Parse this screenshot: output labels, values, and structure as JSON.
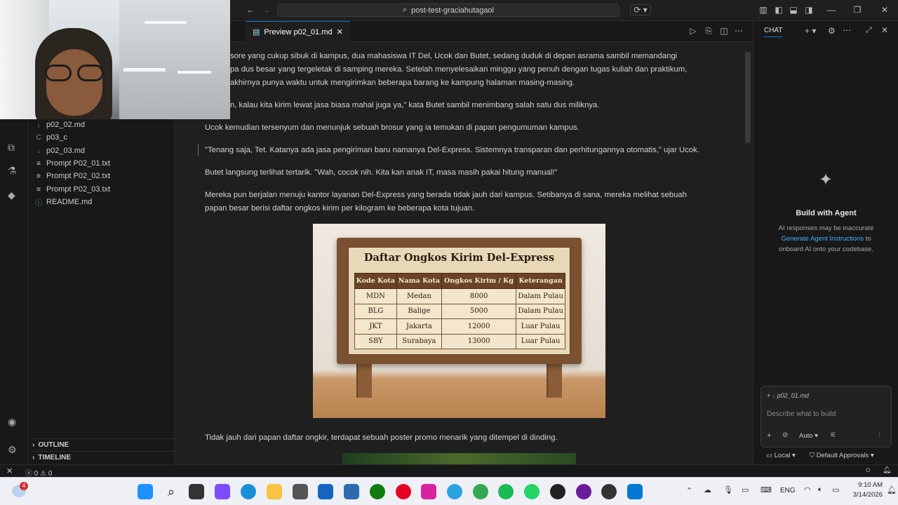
{
  "titlebar": {
    "search_text": "post-test-graciahutagaol"
  },
  "sidebar": {
    "files": [
      {
        "label": "p02_02.md",
        "icon": "markdown-icon"
      },
      {
        "label": "p03_c",
        "icon": "c-file-icon"
      },
      {
        "label": "p02_03.md",
        "icon": "markdown-icon"
      },
      {
        "label": "Prompt P02_01.txt",
        "icon": "text-file-icon"
      },
      {
        "label": "Prompt P02_02.txt",
        "icon": "text-file-icon"
      },
      {
        "label": "Prompt P02_03.txt",
        "icon": "text-file-icon"
      },
      {
        "label": "README.md",
        "icon": "info-icon"
      }
    ],
    "outline": "OUTLINE",
    "timeline": "TIMELINE"
  },
  "editor": {
    "tab_label": "Preview p02_01.md",
    "paragraphs": [
      "sore yang cukup sibuk di kampus, dua mahasiswa IT Del, Ucok dan Butet, sedang duduk di depan asrama sambil memandangi",
      "pa dus besar yang tergeletak di samping mereka. Setelah menyelesaikan minggu yang penuh dengan tugas kuliah dan praktikum,",
      "akhirnya punya waktu untuk mengirimkan beberapa barang ke kampung halaman masing-masing.",
      "n, kalau kita kirim lewat jasa biasa mahal juga ya,\" kata Butet sambil menimbang salah satu dus miliknya.",
      "Ucok kemudian tersenyum dan menunjuk sebuah brosur yang ia temukan di papan pengumuman kampus.",
      "\"Tenang saja, Tet. Katanya ada jasa pengiriman baru namanya Del-Express. Sistemnya transparan dan perhitungannya otomatis,\" ujar Ucok.",
      "Butet langsung terlihat tertarik. \"Wah, cocok nih. Kita kan anak IT, masa masih pakai hitung manual!\"",
      "Mereka pun berjalan menuju kantor layanan Del-Express yang berada tidak jauh dari kampus. Setibanya di sana, mereka melihat sebuah",
      "papan besar berisi daftar ongkos kirim per kilogram ke beberapa kota tujuan.",
      "Tidak jauh dari papan daftar ongkir, terdapat sebuah poster promo menarik yang ditempel di dinding."
    ],
    "board": {
      "title": "Daftar Ongkos Kirim Del-Express",
      "headers": [
        "Kode Kota",
        "Nama Kota",
        "Ongkos Kirim / Kg",
        "Keterangan"
      ],
      "rows": [
        [
          "MDN",
          "Medan",
          "8000",
          "Dalam Pulau"
        ],
        [
          "BLG",
          "Balige",
          "5000",
          "Dalam Pulau"
        ],
        [
          "JKT",
          "Jakarta",
          "12000",
          "Luar Pulau"
        ],
        [
          "SBY",
          "Surabaya",
          "13000",
          "Luar Pulau"
        ]
      ]
    }
  },
  "chat": {
    "title": "CHAT",
    "heading": "Build with Agent",
    "line1": "AI responses may be inaccurate",
    "link": "Generate Agent Instructions",
    "link_suffix": " to",
    "line3": "onboard AI onto your codebase.",
    "context_file": "p02_01.md",
    "input_placeholder": "Describe what to build",
    "mode": "Auto",
    "local": "Local",
    "approvals": "Default Approvals"
  },
  "status": {
    "errors": "0",
    "warnings": "0"
  },
  "taskbar": {
    "lang": "ENG",
    "time": "9:10 AM",
    "date": "3/14/2026",
    "badge": "4"
  },
  "colors": {
    "accent": "#0078d4",
    "link": "#4daafc"
  }
}
